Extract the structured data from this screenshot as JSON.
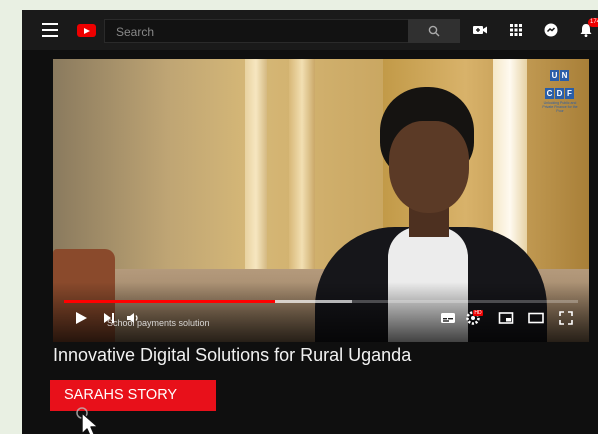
{
  "header": {
    "search_placeholder": "Search",
    "notification_count": "174",
    "icons": [
      "menu-icon",
      "youtube-logo-icon",
      "search-icon",
      "create-video-icon",
      "apps-grid-icon",
      "messages-icon",
      "bell-icon"
    ]
  },
  "video": {
    "chapter_label": "School payments solution",
    "progress_played": 0.41,
    "progress_buffered": 0.56,
    "logo_letters": [
      "U",
      "N",
      "C",
      "D",
      "F"
    ],
    "logo_tagline": "Unlocking Public and Private Finance for the Poor",
    "quality_badge": "HD",
    "controls": [
      "play-icon",
      "next-icon",
      "volume-icon",
      "subtitles-icon",
      "settings-icon",
      "miniplayer-icon",
      "theater-icon",
      "fullscreen-icon"
    ]
  },
  "main": {
    "title": "Innovative Digital Solutions for Rural Uganda",
    "story_button": "SARAHS STORY"
  },
  "colors": {
    "accent_red": "#ff0000",
    "button_red": "#e8101a",
    "background": "#0f0f0f",
    "page_bg": "#e9f0e3"
  }
}
